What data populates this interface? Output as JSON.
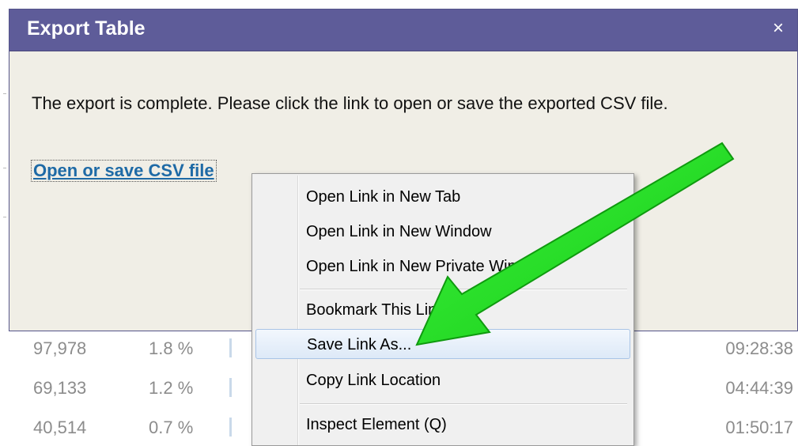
{
  "dialog": {
    "title": "Export Table",
    "close_label": "×",
    "message": "The export is complete. Please click the link to open or save the exported CSV file.",
    "link_label": "Open or save CSV file"
  },
  "context_menu": {
    "items": [
      {
        "label": "Open Link in New Tab"
      },
      {
        "label": "Open Link in New Window"
      },
      {
        "label": "Open Link in New Private Window"
      },
      {
        "label": "Bookmark This Link"
      },
      {
        "label": "Save Link As..."
      },
      {
        "label": "Copy Link Location"
      },
      {
        "label": "Inspect Element (Q)"
      }
    ],
    "highlighted_index": 4
  },
  "background_table": {
    "rows": [
      {
        "value": "97,978",
        "percent": "1.8 %",
        "time": "09:28:38"
      },
      {
        "value": "69,133",
        "percent": "1.2 %",
        "time": "04:44:39"
      },
      {
        "value": "40,514",
        "percent": "0.7 %",
        "time": "01:50:17"
      }
    ]
  },
  "annotation": {
    "arrow_color": "#22dd22",
    "arrow_icon": "green-arrow-icon"
  },
  "colors": {
    "titlebar": "#5e5c99",
    "dialog_bg": "#f0eee6",
    "link": "#1e6aa6",
    "menu_highlight": "#dde9f7"
  }
}
